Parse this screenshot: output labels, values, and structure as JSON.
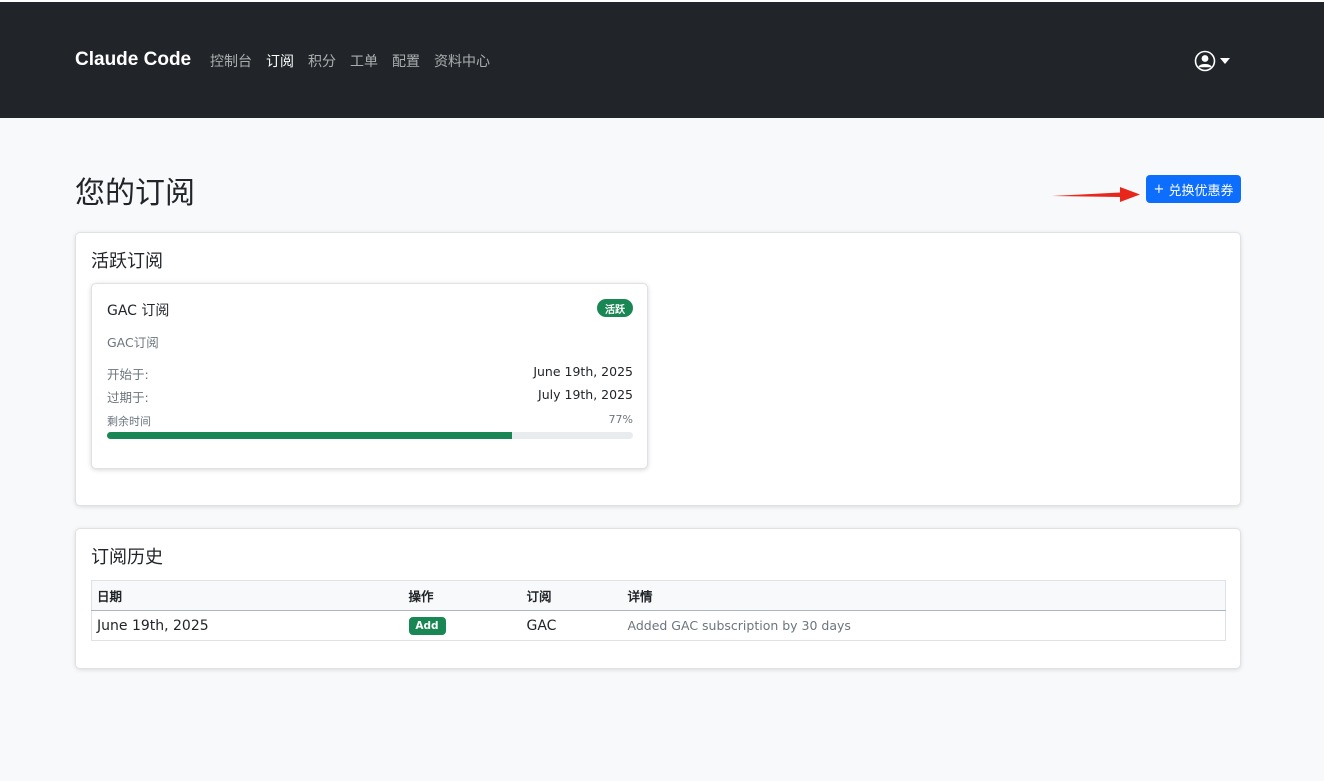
{
  "navbar": {
    "brand": "Claude Code",
    "items": [
      {
        "label": "控制台"
      },
      {
        "label": "订阅"
      },
      {
        "label": "积分"
      },
      {
        "label": "工单"
      },
      {
        "label": "配置"
      },
      {
        "label": "资料中心"
      }
    ],
    "active_item": "订阅",
    "user_icon": "user-circle-icon"
  },
  "page": {
    "title": "您的订阅",
    "redeem_button": {
      "icon": "plus-icon",
      "icon_glyph": "+",
      "label": "兑换优惠券"
    }
  },
  "active_subscriptions": {
    "title": "活跃订阅",
    "subscription": {
      "name": "GAC 订阅",
      "status": "活跃",
      "description": "GAC订阅",
      "start_label": "开始于:",
      "start_date": "June 19th, 2025",
      "end_label": "过期于:",
      "end_date": "July 19th, 2025",
      "remaining_label": "剩余时间",
      "remaining_percent_text": "77%",
      "remaining_fraction": 0.77
    }
  },
  "history": {
    "title": "订阅历史",
    "columns": [
      "日期",
      "操作",
      "订阅",
      "详情"
    ],
    "rows": [
      {
        "date": "June 19th, 2025",
        "action": "Add",
        "subscription": "GAC",
        "detail": "Added GAC subscription by 30 days"
      }
    ]
  },
  "colors": {
    "navbar_bg": "#212529",
    "primary": "#0d6efd",
    "success": "#198754",
    "annotation_arrow": "#e8261c"
  }
}
